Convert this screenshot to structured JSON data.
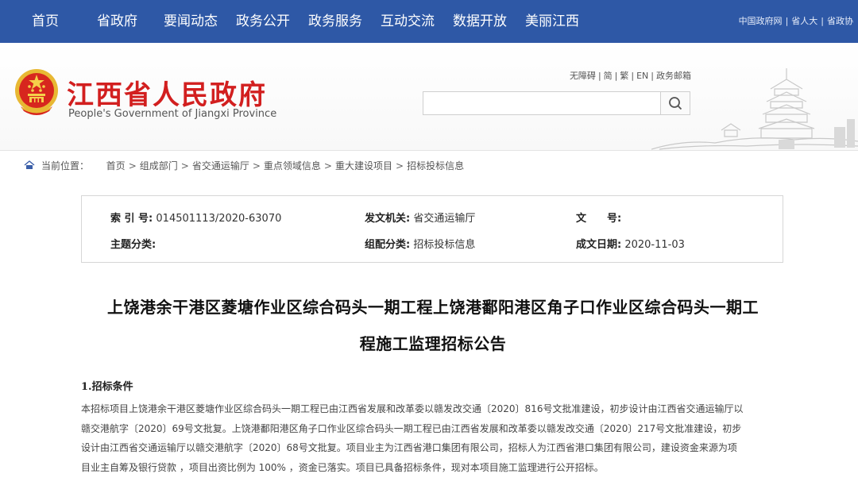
{
  "topnav": {
    "items": [
      "首页",
      "省政府",
      "要闻动态",
      "政务公开",
      "政务服务",
      "互动交流",
      "数据开放",
      "美丽江西"
    ],
    "links": [
      "中国政府网",
      "省人大",
      "省政协"
    ]
  },
  "header": {
    "title_cn": "江西省人民政府",
    "title_en": "People's Government of Jiangxi Province",
    "util_links": [
      "无障碍",
      "简",
      "繁",
      "EN",
      "政务邮箱"
    ],
    "search": {
      "value": "",
      "placeholder": ""
    }
  },
  "breadcrumb": {
    "label": "当前位置：",
    "items": [
      "首页",
      "组成部门",
      "省交通运输厅",
      "重点领域信息",
      "重大建设项目",
      "招标投标信息"
    ],
    "separator": ">"
  },
  "info": {
    "index_label": "索 引 号:",
    "index_value": "014501113/2020-63070",
    "issuer_label": "发文机关:",
    "issuer_value": "省交通运输厅",
    "docno_label": "文　　号:",
    "docno_value": "",
    "topic_label": "主题分类:",
    "topic_value": "",
    "group_label": "组配分类:",
    "group_value": "招标投标信息",
    "date_label": "成文日期:",
    "date_value": "2020-11-03"
  },
  "article": {
    "title_line1": "上饶港余干港区菱塘作业区综合码头一期工程上饶港鄱阳港区角子口作业区综合码头一期工",
    "title_line2": "程施工监理招标公告",
    "section1": "1.招标条件",
    "para_lines": [
      "本招标项目上饶港余干港区菱塘作业区综合码头一期工程已由江西省发展和改革委以赣发改交通〔2020〕816号文批准建设，初步设计由江西省交通运输厅以",
      "赣交港航字〔2020〕69号文批复。上饶港鄱阳港区角子口作业区综合码头一期工程已由江西省发展和改革委以赣发改交通〔2020〕217号文批准建设，初步",
      "设计由江西省交通运输厅以赣交港航字〔2020〕68号文批复。项目业主为江西省港口集团有限公司，招标人为江西省港口集团有限公司，建设资金来源为项",
      "目业主自筹及银行贷款 ，项目出资比例为 100% ，资金已落实。项目已具备招标条件，现对本项目施工监理进行公开招标。"
    ]
  },
  "colors": {
    "nav_bg": "#2e58a6",
    "logo_red": "#d21f1f"
  }
}
